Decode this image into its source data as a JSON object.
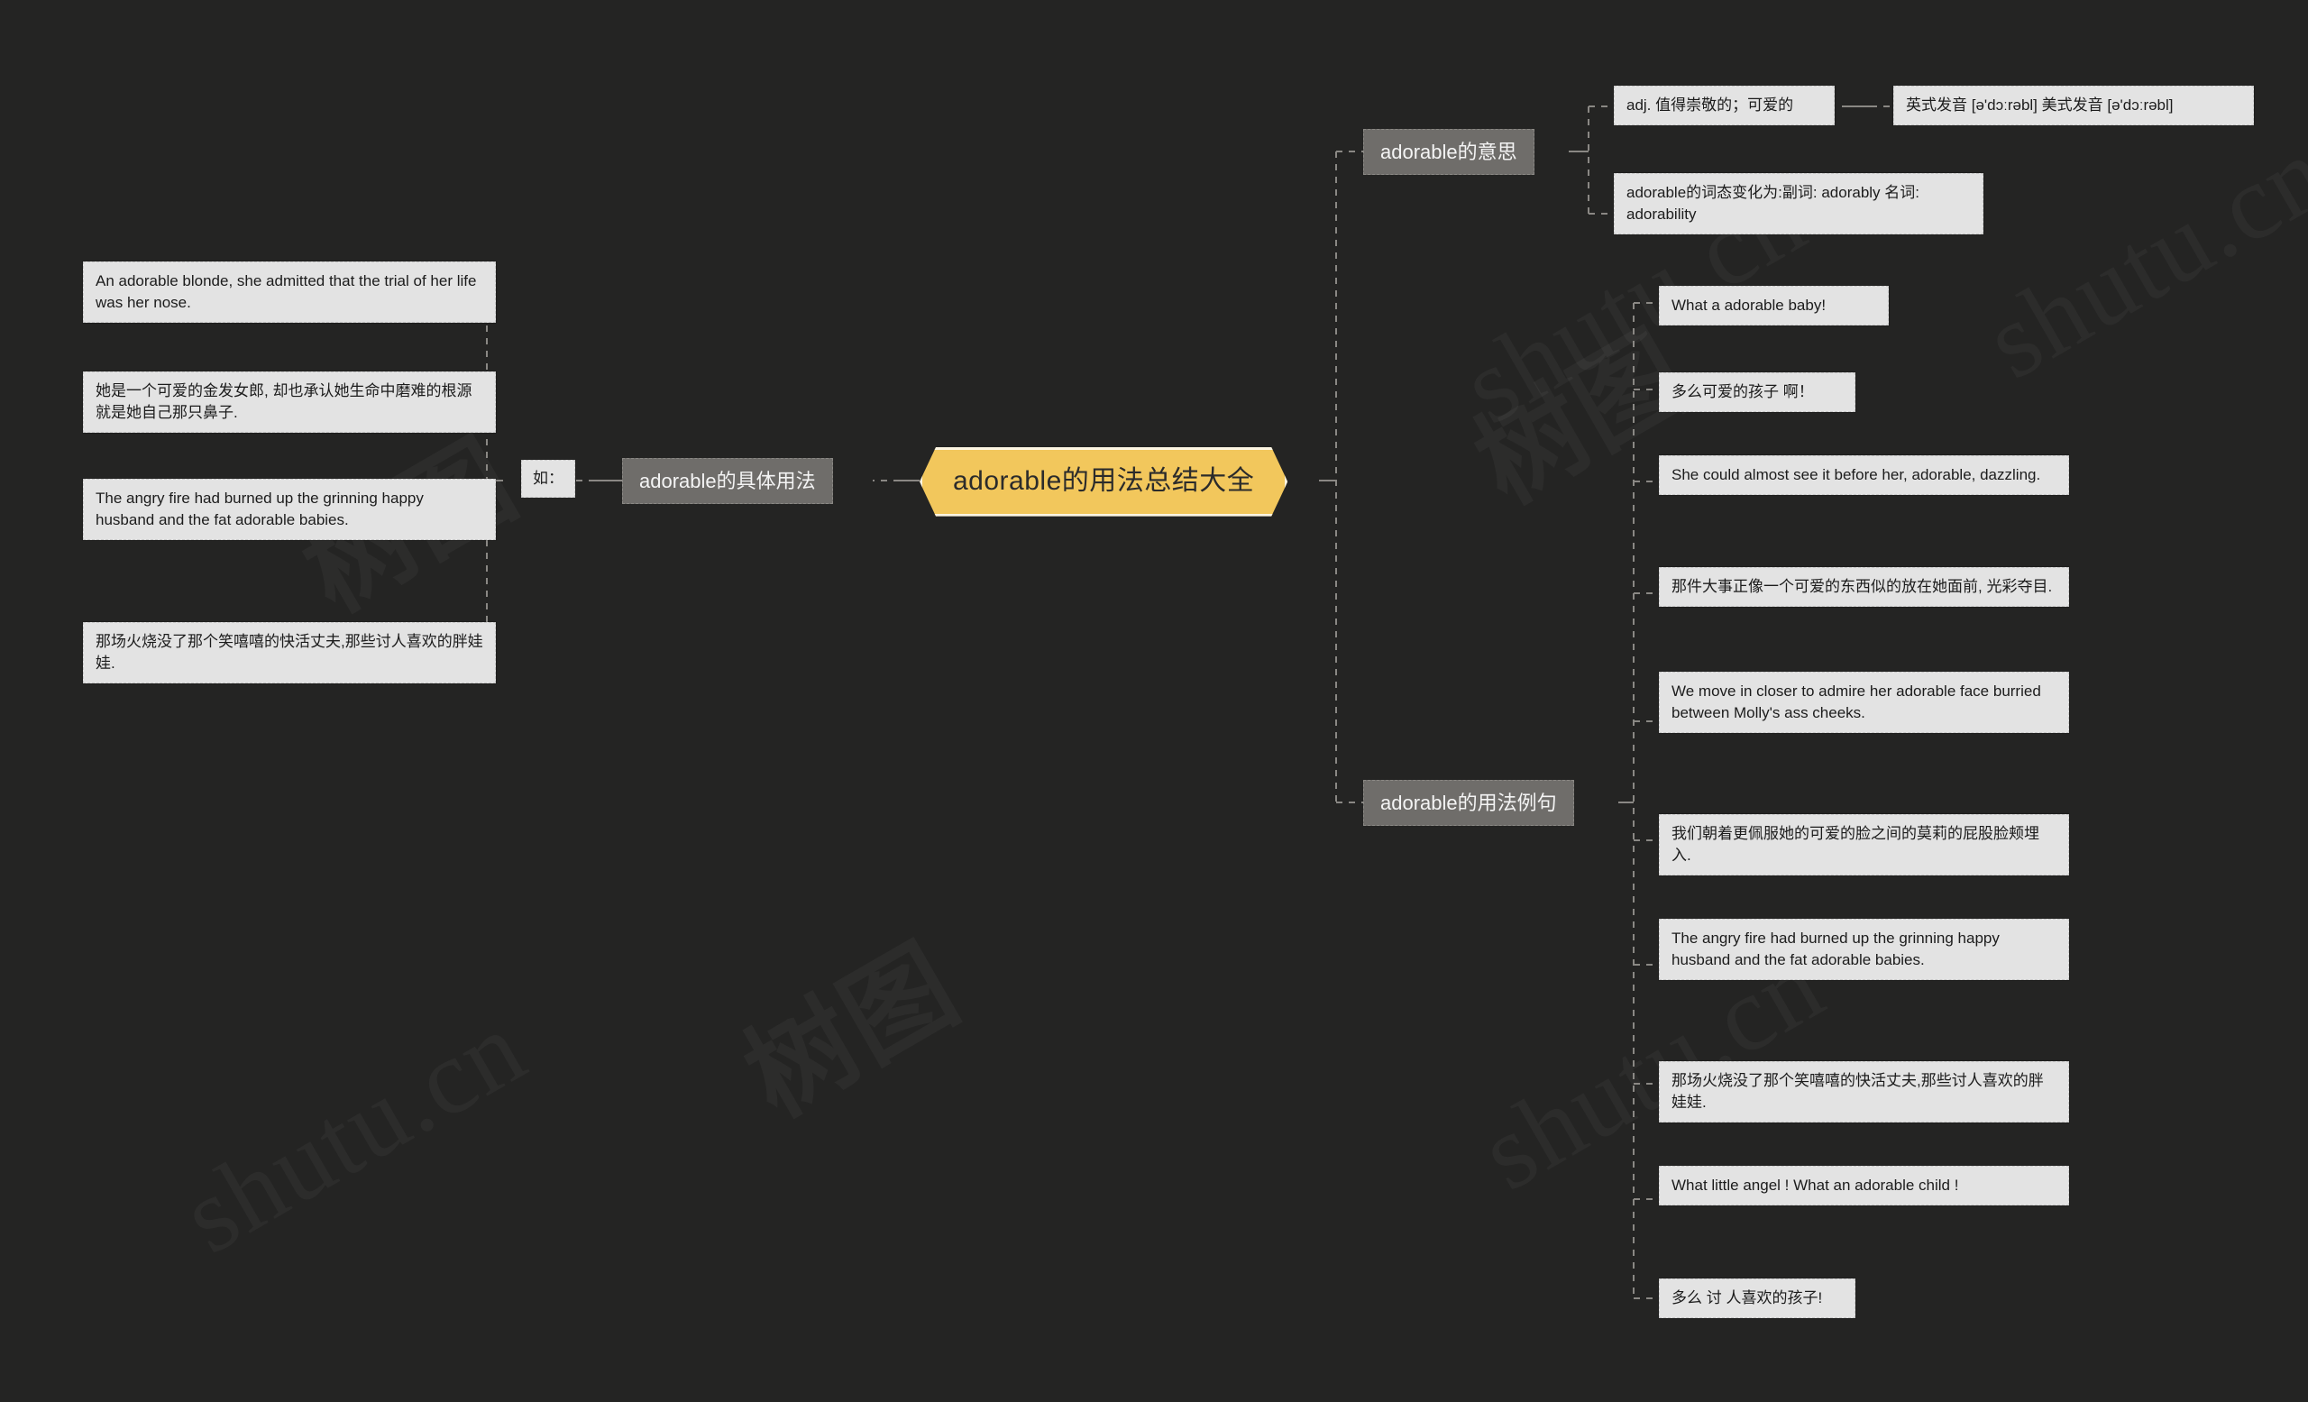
{
  "root": {
    "label": "adorable的用法总结大全"
  },
  "watermark": {
    "text_cn": "树图",
    "text_en": "shutu.cn"
  },
  "left_branch": {
    "connector_label": "如：",
    "label": "adorable的具体用法",
    "items": [
      "An adorable blonde, she admitted that the trial of her life was her nose.",
      "她是一个可爱的金发女郎, 却也承认她生命中磨难的根源就是她自己那只鼻子.",
      "The angry fire had burned up the grinning happy husband and the fat adorable babies.",
      "那场火烧没了那个笑嘻嘻的快活丈夫,那些讨人喜欢的胖娃娃."
    ]
  },
  "right_branches": [
    {
      "label": "adorable的意思",
      "items": [
        "adj. 值得崇敬的；可爱的",
        "adorable的词态变化为:副词: adorably 名词: adorability"
      ],
      "sub_items": [
        "英式发音 [ə'dɔːrəbl] 美式发音 [ə'dɔːrəbl]"
      ]
    },
    {
      "label": "adorable的用法例句",
      "items": [
        "What a adorable baby!",
        "多么可爱的孩子 啊！",
        "She could almost see it before her, adorable, dazzling.",
        "那件大事正像一个可爱的东西似的放在她面前, 光彩夺目.",
        "We move in closer to admire her adorable face burried between Molly's ass cheeks.",
        "我们朝着更佩服她的可爱的脸之间的莫莉的屁股脸颊埋入.",
        "The angry fire had burned up the grinning happy husband and the fat adorable babies.",
        "那场火烧没了那个笑嘻嘻的快活丈夫,那些讨人喜欢的胖娃娃.",
        "What little angel ! What an adorable child !",
        "多么 讨 人喜欢的孩子!"
      ]
    }
  ],
  "colors": {
    "background": "#242423",
    "root_fill": "#f2c75c",
    "root_text": "#2b2b2b",
    "level2_fill": "#6f6d6a",
    "level2_text": "#f4f4f4",
    "leaf_fill": "#e3e3e3",
    "leaf_text": "#1c1c1c",
    "connector": "#8a8884"
  }
}
